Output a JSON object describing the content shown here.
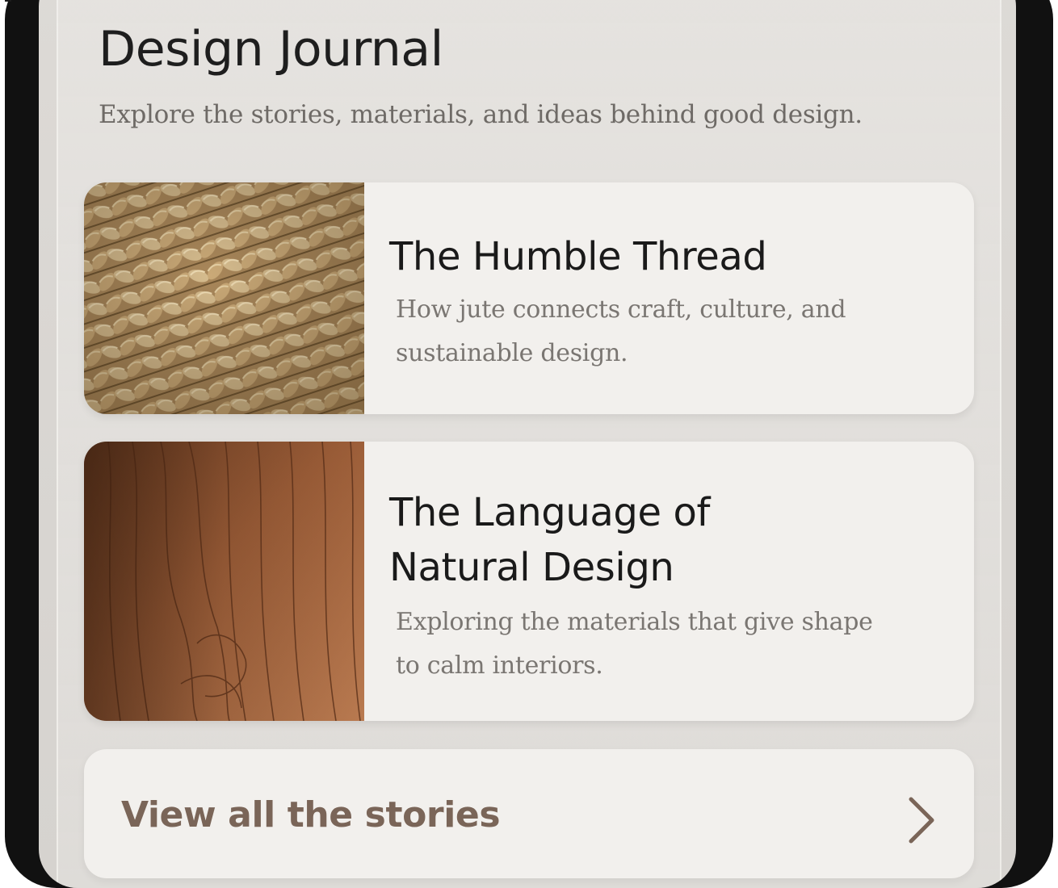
{
  "journal": {
    "title": "Design Journal",
    "subtitle": "Explore the stories, materials, and ideas behind good design."
  },
  "stories": [
    {
      "title": "The Humble Thread",
      "description": "How jute connects craft, culture, and sustainable design.",
      "image": "jute-texture-image"
    },
    {
      "title": "The Language of Natural Design",
      "description": "Exploring the materials that give shape to calm interiors.",
      "image": "wood-grain-image"
    }
  ],
  "view_all": {
    "label": "View all the stories",
    "icon": "chevron-right-icon"
  },
  "colors": {
    "background": "#dcd9d5",
    "card": "#f2f0ed",
    "title": "#1e1e1e",
    "muted": "#7a7672",
    "accent": "#7a6558"
  }
}
